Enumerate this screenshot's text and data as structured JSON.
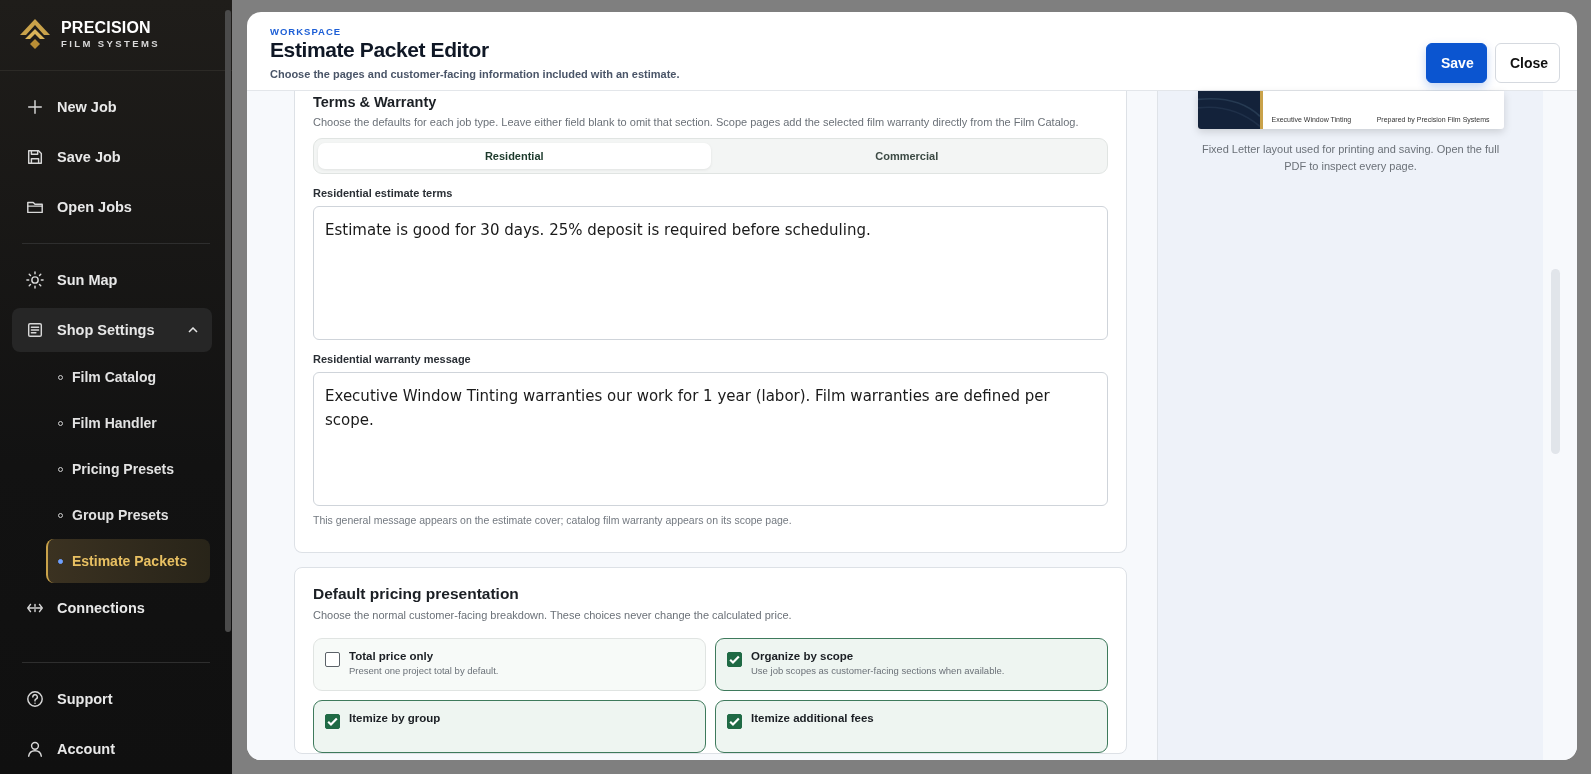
{
  "brand": {
    "name": "PRECISION",
    "tagline": "FILM SYSTEMS"
  },
  "sidebar": {
    "groups": [
      {
        "items": [
          {
            "label": "New Job",
            "kind": "plus"
          },
          {
            "label": "Save Job",
            "kind": "save"
          },
          {
            "label": "Open Jobs",
            "kind": "folder"
          }
        ]
      },
      {
        "items": [
          {
            "label": "Sun Map",
            "kind": "sun"
          },
          {
            "label": "Shop Settings",
            "kind": "list",
            "expanded": true,
            "children": [
              {
                "label": "Film Catalog",
                "selected": false
              },
              {
                "label": "Film Handler",
                "selected": false
              },
              {
                "label": "Pricing Presets",
                "selected": false
              },
              {
                "label": "Group Presets",
                "selected": false
              },
              {
                "label": "Estimate Packets",
                "selected": true
              }
            ]
          },
          {
            "label": "Connections",
            "kind": "link"
          }
        ]
      },
      {
        "items": [
          {
            "label": "Support",
            "kind": "help"
          },
          {
            "label": "Account",
            "kind": "user"
          }
        ]
      }
    ]
  },
  "header": {
    "eyebrow": "WORKSPACE",
    "title": "Estimate Packet Editor",
    "subtitle": "Choose the pages and customer-facing information included with an estimate.",
    "buttons": [
      {
        "label": "Save",
        "kind": "primary"
      },
      {
        "label": "Close",
        "kind": "secondary"
      }
    ]
  },
  "terms": {
    "title": "Terms & Warranty",
    "description": "Choose the defaults for each job type. Leave either field blank to omit that section. Scope pages add the selected film warranty directly from the Film Catalog.",
    "tabs": [
      {
        "label": "Residential",
        "selected": true
      },
      {
        "label": "Commercial",
        "selected": false
      }
    ],
    "fields": [
      {
        "label": "Residential estimate terms",
        "value": "Estimate is good for 30 days. 25% deposit is required before scheduling."
      },
      {
        "label": "Residential warranty message",
        "value": "Executive Window Tinting warranties our work for 1 year (labor). Film warranties are defined per scope."
      }
    ],
    "help": "This general message appears on the estimate cover; catalog film warranty appears on its scope page."
  },
  "pricing": {
    "title": "Default pricing presentation",
    "description": "Choose the normal customer-facing breakdown. These choices never change the calculated price.",
    "options": [
      {
        "title": "Total price only",
        "description": "Present one project total by default.",
        "checked": false
      },
      {
        "title": "Organize by scope",
        "description": "Use job scopes as customer-facing sections when available.",
        "checked": true
      },
      {
        "title": "Itemize by group",
        "checked": true
      },
      {
        "title": "Itemize additional fees",
        "checked": true
      }
    ]
  },
  "preview": {
    "footer_left": "Executive Window Tinting",
    "footer_right": "Prepared by Precision Film Systems",
    "caption": "Fixed Letter layout used for printing and saving. Open the full PDF to inspect every page."
  }
}
